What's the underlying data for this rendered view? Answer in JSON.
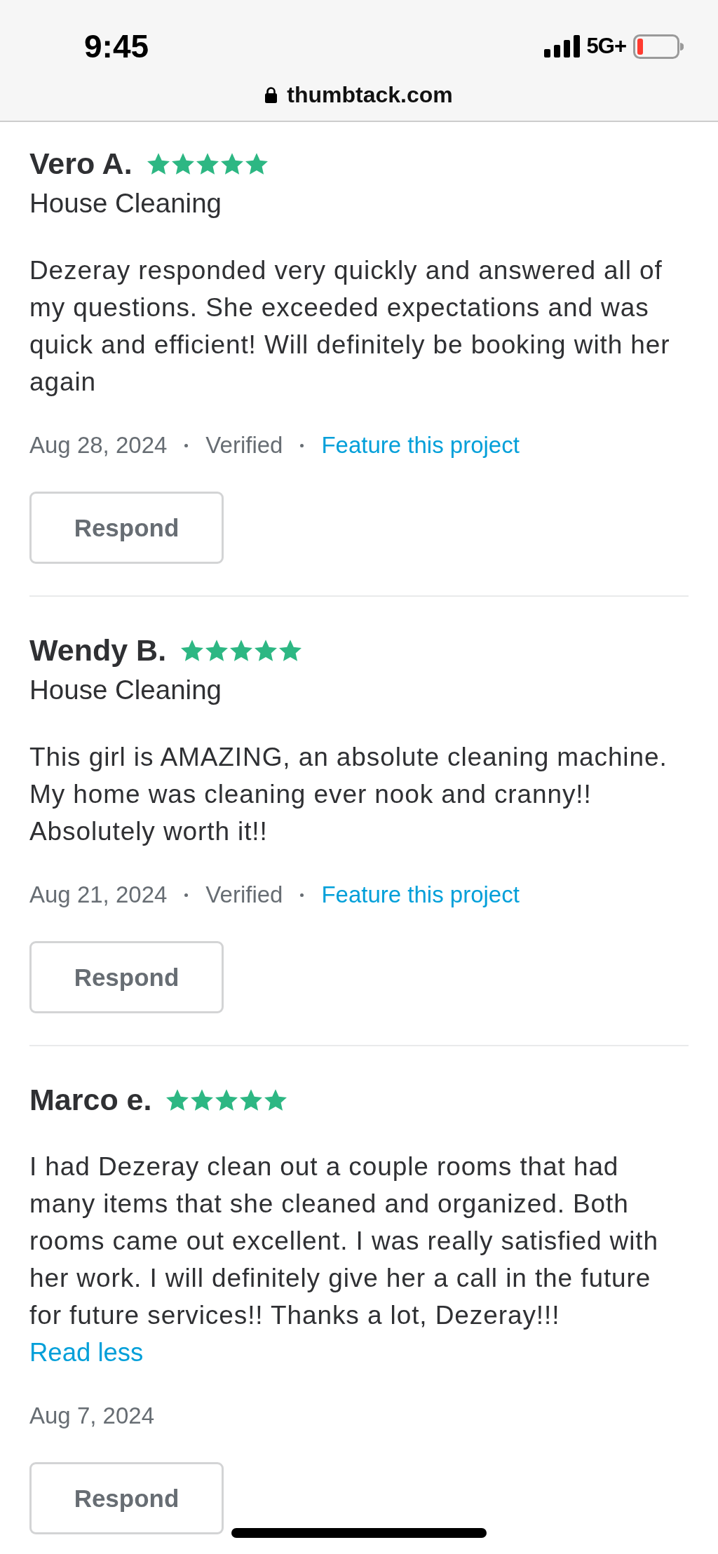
{
  "status_bar": {
    "time": "9:45",
    "network": "5G+"
  },
  "address_bar": {
    "url": "thumbtack.com"
  },
  "reviews": [
    {
      "name": "Vero A.",
      "stars": 5,
      "category": "House Cleaning",
      "text": "Dezeray responded very quickly and answered all of my questions. She exceeded expectations and was quick and efficient! Will definitely be booking with her again",
      "date": "Aug 28, 2024",
      "status": "Verified",
      "action": "Feature this project",
      "button": "Respond"
    },
    {
      "name": "Wendy B.",
      "stars": 5,
      "category": "House Cleaning",
      "text": "This girl is AMAZING, an absolute cleaning machine. My home was cleaning ever nook and cranny!! Absolutely worth it!!",
      "date": "Aug 21, 2024",
      "status": "Verified",
      "action": "Feature this project",
      "button": "Respond"
    },
    {
      "name": "Marco e.",
      "stars": 5,
      "text": "I had Dezeray clean out a couple rooms that had many items that she cleaned and organized. Both rooms came out excellent. I was really satisfied with her work. I will definitely give her a call in the future for future services!! Thanks a lot, Dezeray!!!",
      "toggle": "Read less",
      "date": "Aug 7, 2024",
      "button": "Respond"
    }
  ]
}
